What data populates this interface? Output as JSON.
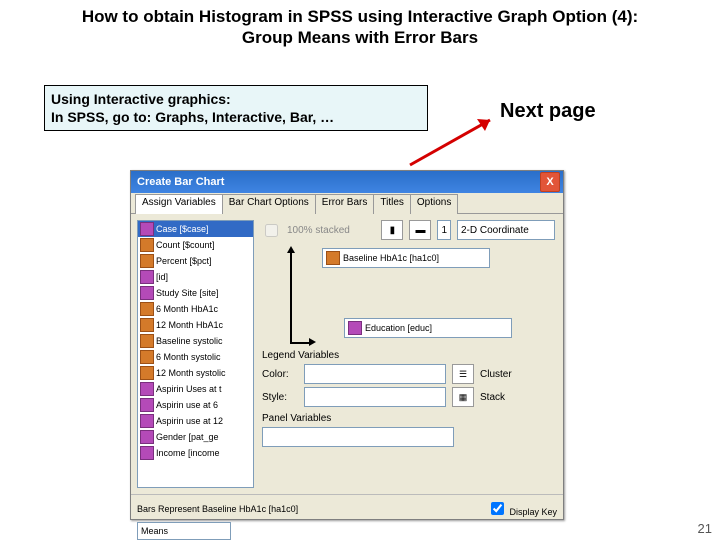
{
  "title_line1": "How to obtain Histogram in SPSS using Interactive Graph Option (4):",
  "title_line2": "Group Means with Error Bars",
  "hint_line1": "Using Interactive graphics:",
  "hint_line2": "In SPSS, go to: Graphs, Interactive, Bar, …",
  "next_page": "Next page",
  "page_number": "21",
  "window": {
    "title": "Create Bar Chart",
    "close": "X",
    "tabs": [
      "Assign Variables",
      "Bar Chart Options",
      "Error Bars",
      "Titles",
      "Options"
    ],
    "active_tab": 0,
    "stacked_label": "100% stacked",
    "coord_count": "1",
    "coord_label": "2-D Coordinate",
    "variables": [
      {
        "label": "Case [$case]",
        "type": "cat",
        "sel": true
      },
      {
        "label": "Count [$count]",
        "type": "scale"
      },
      {
        "label": "Percent [$pct]",
        "type": "scale"
      },
      {
        "label": "[id]",
        "type": "cat"
      },
      {
        "label": "Study Site [site]",
        "type": "cat"
      },
      {
        "label": "6 Month HbA1c",
        "type": "scale"
      },
      {
        "label": "12 Month HbA1c",
        "type": "scale"
      },
      {
        "label": "Baseline systolic",
        "type": "scale"
      },
      {
        "label": "6 Month systolic",
        "type": "scale"
      },
      {
        "label": "12 Month systolic",
        "type": "scale"
      },
      {
        "label": "Aspirin Uses at t",
        "type": "cat"
      },
      {
        "label": "Aspirin use at 6",
        "type": "cat"
      },
      {
        "label": "Aspirin use at 12",
        "type": "cat"
      },
      {
        "label": "Gender [pat_ge",
        "type": "cat"
      },
      {
        "label": "Income [income",
        "type": "cat"
      }
    ],
    "y_target": "Baseline HbA1c [ha1c0]",
    "x_target": "Education [educ]",
    "legend_heading": "Legend Variables",
    "color_label": "Color:",
    "style_label": "Style:",
    "cluster_label": "Cluster",
    "stack_label": "Stack",
    "panel_heading": "Panel Variables",
    "bars_represent": "Bars Represent Baseline HbA1c [ha1c0]",
    "display_key": "Display Key",
    "means_value": "Means"
  }
}
